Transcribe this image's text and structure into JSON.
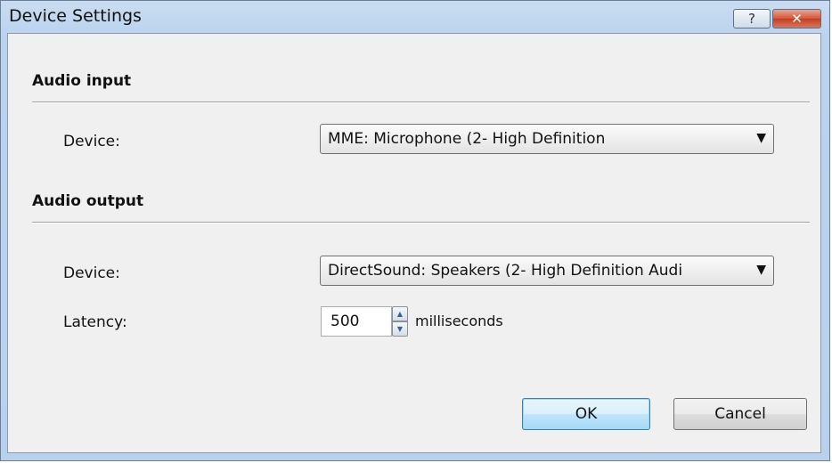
{
  "window": {
    "title": "Device Settings",
    "help_label": "?",
    "close_label": "✕"
  },
  "audio_input": {
    "heading": "Audio input",
    "device_label": "Device:",
    "device_value": "MME: Microphone (2- High Definition"
  },
  "audio_output": {
    "heading": "Audio output",
    "device_label": "Device:",
    "device_value": "DirectSound: Speakers (2- High Definition Audi",
    "latency_label": "Latency:",
    "latency_value": "500",
    "latency_unit": "milliseconds"
  },
  "buttons": {
    "ok": "OK",
    "cancel": "Cancel"
  },
  "icons": {
    "dropdown": "▼",
    "spin_up": "▲",
    "spin_down": "▼"
  }
}
